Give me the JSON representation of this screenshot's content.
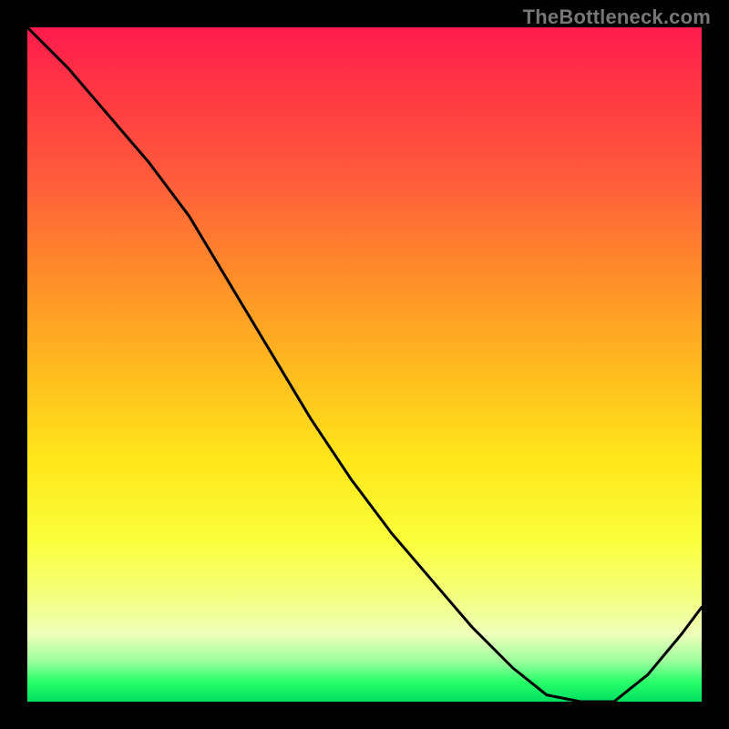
{
  "watermark": "TheBottleneck.com",
  "marker": {
    "label": "",
    "x_frac": 0.77
  },
  "chart_data": {
    "type": "line",
    "title": "",
    "xlabel": "",
    "ylabel": "",
    "xlim": [
      0,
      1
    ],
    "ylim": [
      0,
      1
    ],
    "series": [
      {
        "name": "curve",
        "x": [
          0.0,
          0.06,
          0.12,
          0.18,
          0.24,
          0.3,
          0.36,
          0.42,
          0.48,
          0.54,
          0.6,
          0.66,
          0.72,
          0.77,
          0.82,
          0.87,
          0.92,
          0.97,
          1.0
        ],
        "y": [
          1.0,
          0.94,
          0.87,
          0.8,
          0.72,
          0.62,
          0.52,
          0.42,
          0.33,
          0.25,
          0.18,
          0.11,
          0.05,
          0.01,
          0.0,
          0.0,
          0.04,
          0.1,
          0.14
        ]
      }
    ]
  }
}
